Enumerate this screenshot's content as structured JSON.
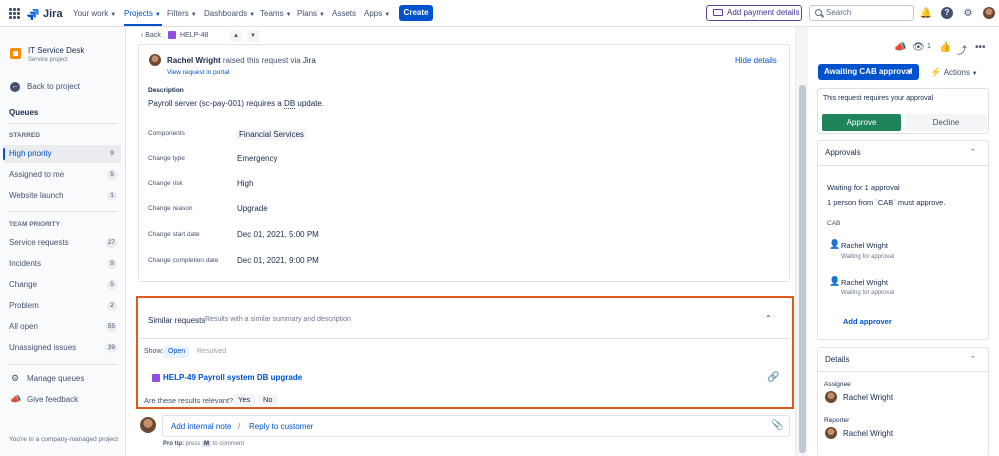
{
  "topnav": {
    "logo": "Jira",
    "items": [
      "Your work",
      "Projects",
      "Filters",
      "Dashboards",
      "Teams",
      "Plans",
      "Assets",
      "Apps"
    ],
    "create": "Create",
    "add_payment": "Add payment details",
    "search_placeholder": "Search"
  },
  "sidebar": {
    "project_name": "IT Service Desk",
    "project_type": "Service project",
    "back": "Back to project",
    "queues": "Queues",
    "starred_head": "STARRED",
    "starred": [
      {
        "label": "High priority",
        "count": "9"
      },
      {
        "label": "Assigned to me",
        "count": "5"
      },
      {
        "label": "Website launch",
        "count": "1"
      }
    ],
    "team_head": "TEAM PRIORITY",
    "team": [
      {
        "label": "Service requests",
        "count": "27"
      },
      {
        "label": "Incidents",
        "count": "9"
      },
      {
        "label": "Change",
        "count": "5"
      },
      {
        "label": "Problem",
        "count": "2"
      },
      {
        "label": "All open",
        "count": "55"
      },
      {
        "label": "Unassigned issues",
        "count": "39"
      }
    ],
    "manage_queues": "Manage queues",
    "feedback": "Give feedback",
    "footer": "You're in a company-managed project"
  },
  "breadcrumb": {
    "back": "Back",
    "key": "HELP-48"
  },
  "request": {
    "raised_by": "Rachel Wright",
    "raised_mid": " raised this request via ",
    "raised_via": "Jira",
    "view_portal": "View request in portal",
    "hide_details": "Hide details",
    "desc_label": "Description",
    "desc_pre": "Payroll server (sc-pay-001) requires a ",
    "desc_ul": "DB",
    "desc_post": " update."
  },
  "fields": [
    {
      "label": "Components",
      "value": "Financial Services"
    },
    {
      "label": "Change type",
      "value": "Emergency"
    },
    {
      "label": "Change risk",
      "value": "High"
    },
    {
      "label": "Change reason",
      "value": "Upgrade"
    },
    {
      "label": "Change start date",
      "value": "Dec 01, 2021, 5:00 PM"
    },
    {
      "label": "Change completion date",
      "value": "Dec 01, 2021, 9:00 PM"
    }
  ],
  "similar": {
    "title": "Similar requests",
    "subtitle": "Results with a similar summary and description",
    "show": "Show:",
    "open": "Open",
    "resolved": "Resolved",
    "issue": "HELP-49 Payroll system DB upgrade",
    "relevant": "Are these results relevant?",
    "yes": "Yes",
    "no": "No"
  },
  "comment": {
    "add_note": "Add internal note",
    "slash": "/",
    "reply": "Reply to customer",
    "protip_label": "Pro tip:",
    "protip_press": "press",
    "protip_key": "M",
    "protip_rest": "to comment"
  },
  "right": {
    "watch_count": "1",
    "status": "Awaiting CAB approval",
    "actions": "Actions",
    "approval_prompt": "This request requires your approval",
    "approve": "Approve",
    "decline": "Decline",
    "approvals_head": "Approvals",
    "waiting": "Waiting for 1 approval",
    "waiting_sub": "1 person from `CAB` must approve.",
    "cab": "CAB",
    "approvers": [
      {
        "name": "Rachel Wright",
        "status": "Waiting for approval"
      },
      {
        "name": "Rachel Wright",
        "status": "Waiting for approval"
      }
    ],
    "add_approver": "Add approver",
    "details_head": "Details",
    "assignee_label": "Assignee",
    "assignee": "Rachel Wright",
    "reporter_label": "Reporter",
    "reporter": "Rachel Wright"
  }
}
